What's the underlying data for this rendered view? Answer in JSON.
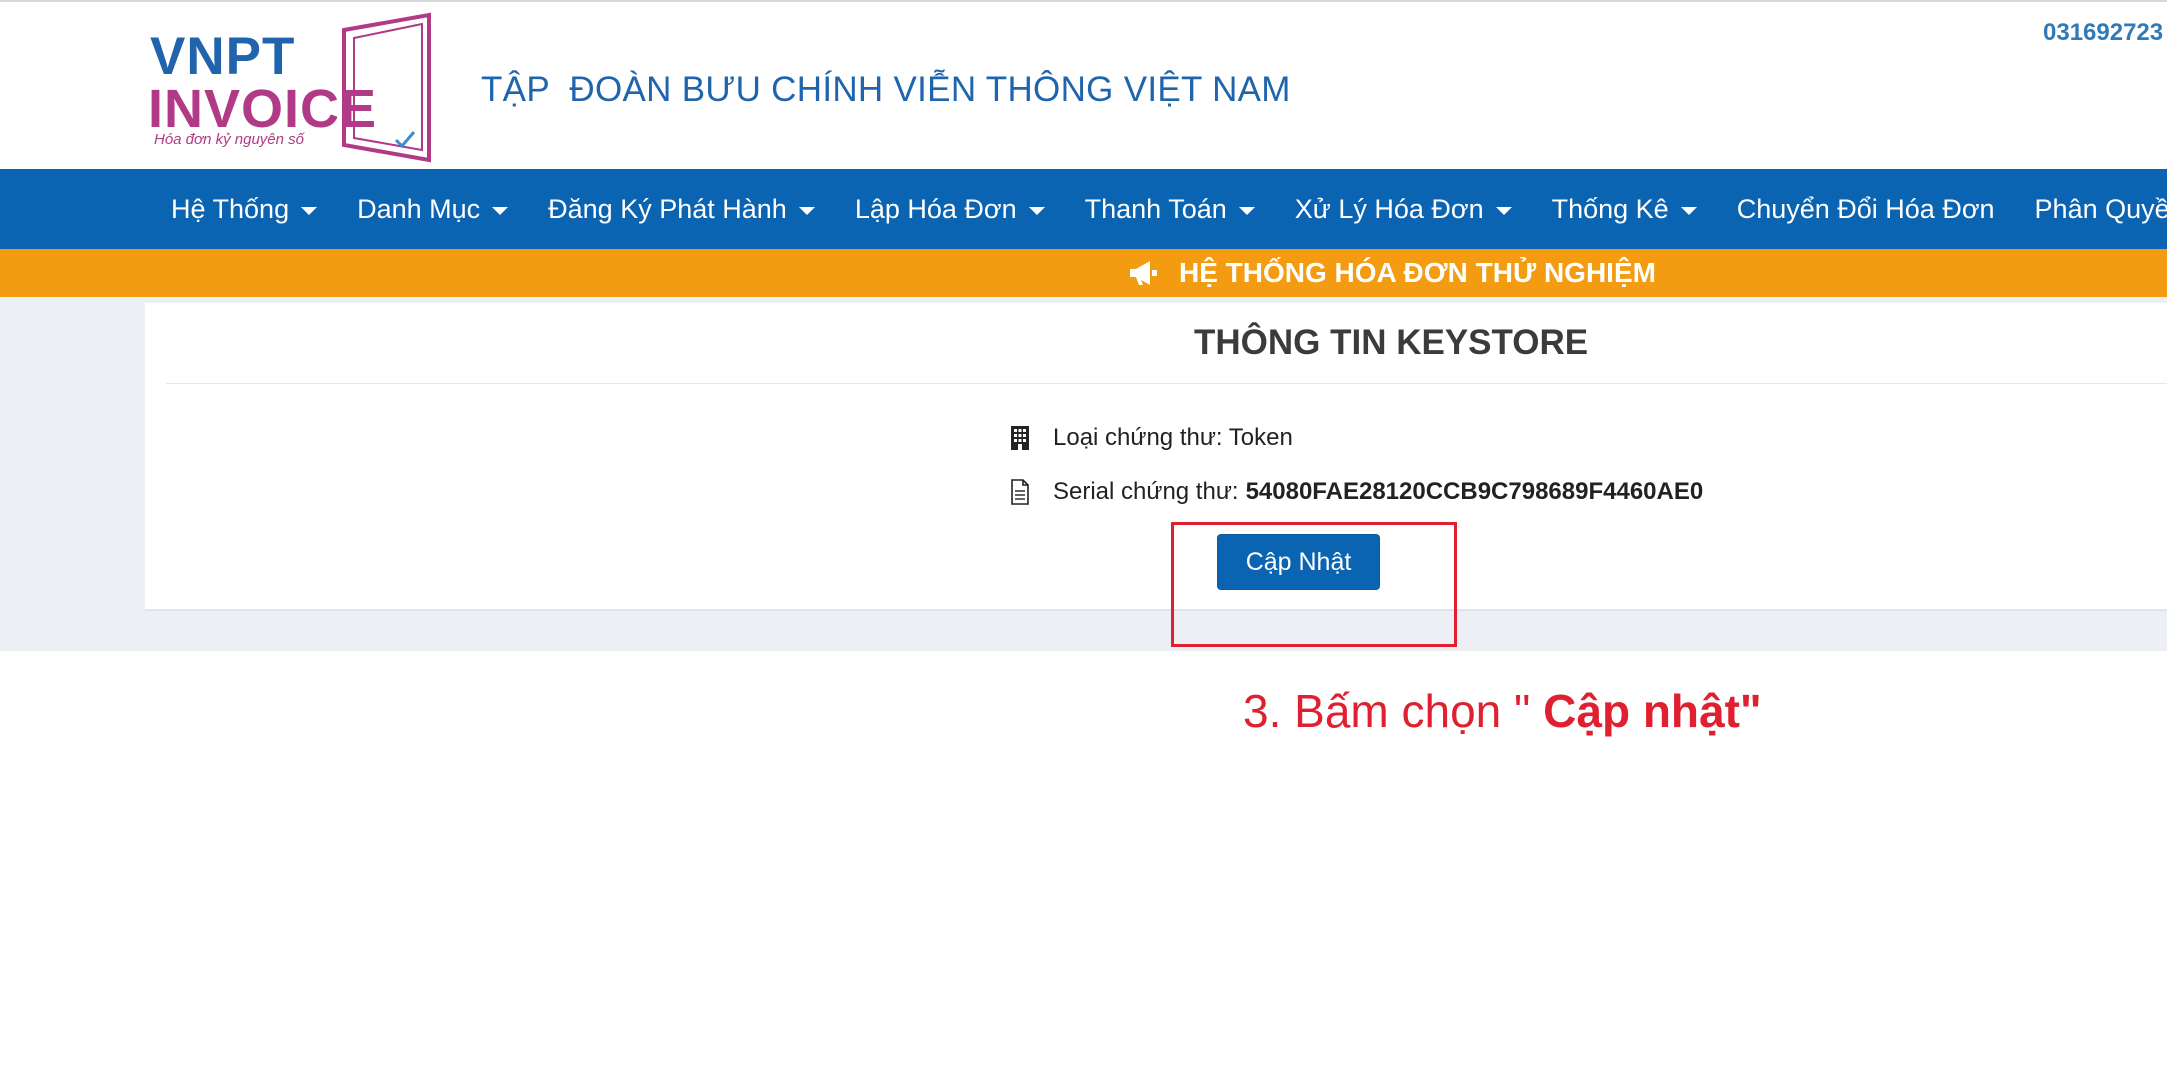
{
  "header": {
    "logo_line1": "VNPT",
    "logo_line2": "INVOICE",
    "logo_tagline": "Hóa đơn kỷ nguyên số",
    "company_name": "TẬP  ĐOÀN BƯU CHÍNH VIỄN THÔNG VIỆT NAM",
    "tax_code": "031692723"
  },
  "nav": {
    "items": [
      {
        "label": "Hệ Thống",
        "has_dropdown": true
      },
      {
        "label": "Danh Mục",
        "has_dropdown": true
      },
      {
        "label": "Đăng Ký Phát Hành",
        "has_dropdown": true
      },
      {
        "label": "Lập Hóa Đơn",
        "has_dropdown": true
      },
      {
        "label": "Thanh Toán",
        "has_dropdown": true
      },
      {
        "label": "Xử Lý Hóa Đơn",
        "has_dropdown": true
      },
      {
        "label": "Thống Kê",
        "has_dropdown": true
      },
      {
        "label": "Chuyển Đổi Hóa Đơn",
        "has_dropdown": false
      },
      {
        "label": "Phân Quyền",
        "has_dropdown": true
      }
    ]
  },
  "banner": {
    "icon": "megaphone-icon",
    "text": "HỆ THỐNG HÓA ĐƠN THỬ NGHIỆM"
  },
  "keystore": {
    "title": "THÔNG TIN KEYSTORE",
    "cert_type_icon": "building-icon",
    "cert_type_label": "Loại chứng thư: Token",
    "serial_icon": "document-icon",
    "serial_label": "Serial chứng thư:",
    "serial_value": "54080FAE28120CCB9C798689F4460AE0",
    "update_button": "Cập Nhật"
  },
  "annotation": {
    "step_text": "3. Bấm chọn \" ",
    "step_bold": "Cập nhật\""
  },
  "colors": {
    "nav_blue": "#0b64b2",
    "banner_orange": "#f39c12",
    "logo_blue": "#1f64ad",
    "logo_magenta": "#b03a86",
    "annotation_red": "#e02030",
    "content_bg": "#ecf0f5"
  }
}
